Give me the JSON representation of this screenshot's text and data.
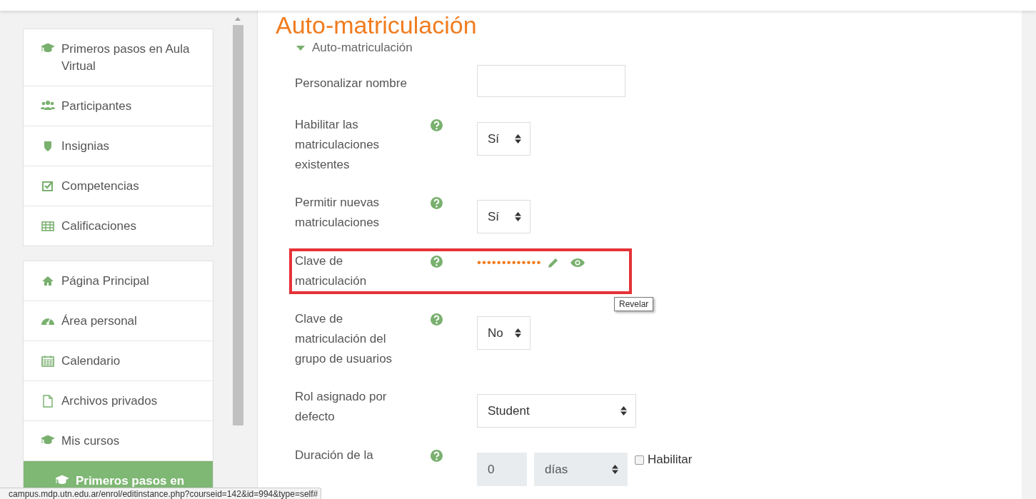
{
  "page_title": "Auto-matriculación",
  "sidebar": {
    "groups": [
      {
        "items": [
          {
            "label": "Primeros pasos en Aula Virtual",
            "selected": false
          },
          {
            "label": "Participantes",
            "selected": false
          },
          {
            "label": "Insignias",
            "selected": false
          },
          {
            "label": "Competencias",
            "selected": false
          },
          {
            "label": "Calificaciones",
            "selected": false
          }
        ]
      },
      {
        "items": [
          {
            "label": "Página Principal",
            "selected": false
          },
          {
            "label": "Área personal",
            "selected": false
          },
          {
            "label": "Calendario",
            "selected": false
          },
          {
            "label": "Archivos privados",
            "selected": false
          },
          {
            "label": "Mis cursos",
            "selected": false
          },
          {
            "label": "Primeros pasos en",
            "selected": true
          }
        ]
      }
    ]
  },
  "section": {
    "label": "Auto-matriculación",
    "expanded": true
  },
  "fields": [
    {
      "kind": "text",
      "label": "Personalizar nombre",
      "help": false,
      "highlighted": false
    },
    {
      "kind": "select",
      "label": "Habilitar las matriculaciones existentes",
      "help": true,
      "value": "Sí",
      "highlighted": false
    },
    {
      "kind": "select",
      "label": "Permitir nuevas matriculaciones",
      "help": true,
      "value": "Sí",
      "highlighted": false
    },
    {
      "kind": "password",
      "label": "Clave de matriculación",
      "help": true,
      "value": "•••••••••••••",
      "highlighted": true,
      "tooltip": "Revelar"
    },
    {
      "kind": "select",
      "label": "Clave de matriculación del grupo de usuarios",
      "help": true,
      "value": "No",
      "highlighted": false
    },
    {
      "kind": "select-wide",
      "label": "Rol asignado por defecto",
      "help": false,
      "value": "Student",
      "highlighted": false
    },
    {
      "kind": "duration",
      "label": "Duración de la",
      "help": true,
      "value": "0",
      "unit": "días",
      "disabled": true,
      "checkbox_label": "Habilitar",
      "checked": false,
      "highlighted": false
    }
  ],
  "status_bar": "campus.mdp.utn.edu.ar/enrol/editinstance.php?courseid=142&id=994&type=self#"
}
